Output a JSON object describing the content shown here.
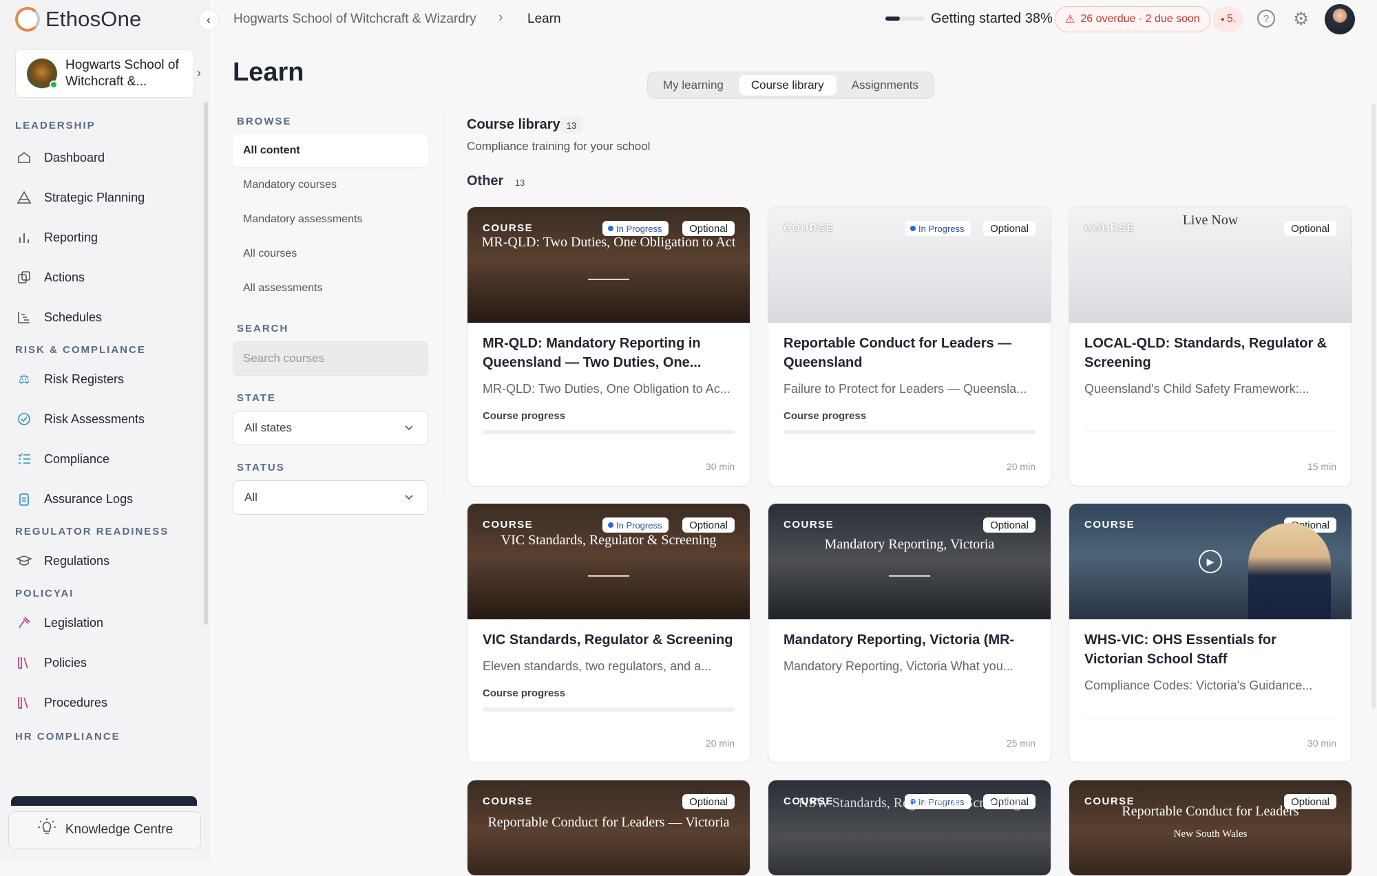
{
  "app": {
    "name": "EthosOne"
  },
  "sidebar": {
    "school_name": "Hogwarts School of Witchcraft &...",
    "sections": [
      {
        "label": "LEADERSHIP",
        "items": [
          {
            "label": "Dashboard",
            "icon": "home-icon"
          },
          {
            "label": "Strategic Planning",
            "icon": "triangle-icon"
          },
          {
            "label": "Reporting",
            "icon": "bar-chart-icon"
          },
          {
            "label": "Actions",
            "icon": "copy-icon"
          },
          {
            "label": "Schedules",
            "icon": "timeline-icon"
          }
        ]
      },
      {
        "label": "RISK & COMPLIANCE",
        "items": [
          {
            "label": "Risk Registers",
            "icon": "scales-icon"
          },
          {
            "label": "Risk Assessments",
            "icon": "check-circle-icon"
          },
          {
            "label": "Compliance",
            "icon": "checklist-icon"
          },
          {
            "label": "Assurance Logs",
            "icon": "clipboard-icon"
          }
        ]
      },
      {
        "label": "REGULATOR READINESS",
        "items": [
          {
            "label": "Regulations",
            "icon": "graduation-cap-icon"
          }
        ]
      },
      {
        "label": "POLICYAI",
        "items": [
          {
            "label": "Legislation",
            "icon": "gavel-icon"
          },
          {
            "label": "Policies",
            "icon": "books-icon"
          },
          {
            "label": "Procedures",
            "icon": "books-icon"
          }
        ]
      },
      {
        "label": "HR COMPLIANCE",
        "items": []
      }
    ],
    "knowledge_centre": "Knowledge Centre"
  },
  "topbar": {
    "breadcrumb_school": "Hogwarts School of Witchcraft & Wizardry",
    "breadcrumb_sep": "›",
    "breadcrumb_current": "Learn",
    "getting_started": "Getting started 38%",
    "getting_started_progress": 0.38,
    "overdue": "26 overdue · 2 due soon",
    "alert_count": "5."
  },
  "page": {
    "title": "Learn"
  },
  "tabs": [
    {
      "label": "My learning",
      "active": false
    },
    {
      "label": "Course library",
      "active": true
    },
    {
      "label": "Assignments",
      "active": false
    }
  ],
  "filters": {
    "browse_label": "BROWSE",
    "browse_items": [
      "All content",
      "Mandatory courses",
      "Mandatory assessments",
      "All courses",
      "All assessments"
    ],
    "search_label": "SEARCH",
    "search_placeholder": "Search courses",
    "state_label": "STATE",
    "state_value": "All states",
    "status_label": "STATUS",
    "status_value": "All"
  },
  "library": {
    "title": "Course library",
    "count": "13",
    "subtitle": "Compliance training for your school",
    "group_title": "Other",
    "group_count": "13"
  },
  "labels": {
    "course": "COURSE",
    "in_progress": "In Progress",
    "optional": "Optional",
    "course_progress": "Course progress"
  },
  "courses": [
    {
      "thumb_heading": "MR-QLD: Two Duties, One Obligation to Act",
      "title": "MR-QLD: Mandatory Reporting in Queensland — Two Duties, One...",
      "desc": "MR-QLD: Two Duties, One Obligation to Ac...",
      "duration": "30 min",
      "progress": 0.0
    },
    {
      "thumb_heading": "",
      "title": "Reportable Conduct for Leaders — Queensland",
      "desc": "Failure to Protect for Leaders — Queensla...",
      "duration": "20 min",
      "progress": 0.0
    },
    {
      "thumb_heading": "Live Now",
      "title": "LOCAL-QLD: Standards, Regulator & Screening",
      "desc": "Queensland's Child Safety Framework:...",
      "duration": "15 min"
    },
    {
      "thumb_heading": "VIC Standards, Regulator & Screening",
      "title": "VIC Standards, Regulator & Screening",
      "desc": "Eleven standards, two regulators, and a...",
      "duration": "20 min",
      "progress": 0.0
    },
    {
      "thumb_heading": "Mandatory Reporting, Victoria",
      "title": "Mandatory Reporting, Victoria (MR-VIC)",
      "desc": "Mandatory Reporting, Victoria What you...",
      "duration": "25 min"
    },
    {
      "thumb_heading": "",
      "title": "WHS-VIC: OHS Essentials for Victorian School Staff",
      "desc": "Compliance Codes: Victoria's Guidance...",
      "duration": "30 min"
    },
    {
      "thumb_heading": "Reportable Conduct for Leaders — Victoria"
    },
    {
      "thumb_heading": "NSW Standards, Regulator & Screening"
    },
    {
      "thumb_heading": "Reportable Conduct for Leaders",
      "thumb_sub": "New South Wales"
    }
  ]
}
